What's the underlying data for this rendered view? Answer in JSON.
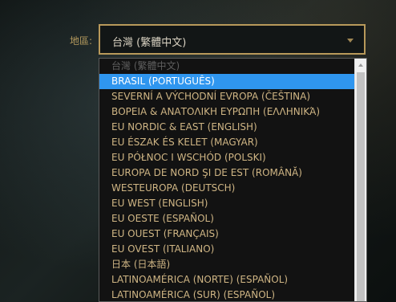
{
  "region": {
    "label": "地區:",
    "selected_value": "台灣 (繁體中文)"
  },
  "dropdown": {
    "options": [
      {
        "label": "台灣 (繁體中文)",
        "state": "disabled"
      },
      {
        "label": "BRASIL (PORTUGUÊS)",
        "state": "highlighted"
      },
      {
        "label": "SEVERNÍ A VÝCHODNÍ EVROPA (ČEŠTINA)",
        "state": "normal"
      },
      {
        "label": "ΒΟΡΕΙΑ & ΑΝΑΤΟΛΙΚΗ ΕΥΡΩΠΗ (ΕΛΛΗΝΙΚΆ)",
        "state": "normal"
      },
      {
        "label": "EU NORDIC & EAST (ENGLISH)",
        "state": "normal"
      },
      {
        "label": "EU ÉSZAK ÉS KELET (MAGYAR)",
        "state": "normal"
      },
      {
        "label": "EU PÓŁNOC I WSCHÓD (POLSKI)",
        "state": "normal"
      },
      {
        "label": "EUROPA DE NORD ŞI DE EST (ROMÂNĂ)",
        "state": "normal"
      },
      {
        "label": "WESTEUROPA (DEUTSCH)",
        "state": "normal"
      },
      {
        "label": "EU WEST (ENGLISH)",
        "state": "normal"
      },
      {
        "label": "EU OESTE (ESPAÑOL)",
        "state": "normal"
      },
      {
        "label": "EU OUEST (FRANÇAIS)",
        "state": "normal"
      },
      {
        "label": "EU OVEST (ITALIANO)",
        "state": "normal"
      },
      {
        "label": "日本 (日本語)",
        "state": "normal"
      },
      {
        "label": "LATINOAMÉRICA (NORTE) (ESPAÑOL)",
        "state": "normal"
      },
      {
        "label": "LATINOAMÉRICA (SUR) (ESPAÑOL)",
        "state": "normal"
      }
    ]
  },
  "colors": {
    "accent_gold": "#b8995a",
    "option_text": "#cfb584",
    "highlight": "#2f96ef"
  },
  "icons": {
    "caret": "chevron-down-icon",
    "scroll_up": "scroll-up-arrow-icon"
  }
}
